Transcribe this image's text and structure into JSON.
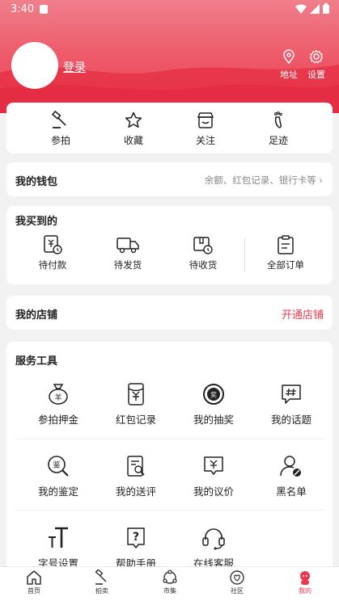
{
  "status": {
    "time": "3:40"
  },
  "header": {
    "login": "登录",
    "address": "地址",
    "settings": "设置"
  },
  "quick": [
    {
      "label": "参拍",
      "icon": "gavel-icon"
    },
    {
      "label": "收藏",
      "icon": "star-icon"
    },
    {
      "label": "关注",
      "icon": "shop-icon"
    },
    {
      "label": "足迹",
      "icon": "footprint-icon"
    }
  ],
  "wallet": {
    "title": "我的钱包",
    "hint": "余额、红包记录、银行卡等 ›"
  },
  "bought": {
    "title": "我买到的",
    "items": [
      {
        "label": "待付款",
        "icon": "payment-pending-icon"
      },
      {
        "label": "待发货",
        "icon": "truck-icon"
      },
      {
        "label": "待收货",
        "icon": "package-icon"
      },
      {
        "label": "全部订单",
        "icon": "clipboard-icon"
      }
    ]
  },
  "shop": {
    "title": "我的店铺",
    "action": "开通店铺"
  },
  "tools": {
    "title": "服务工具",
    "items": [
      {
        "label": "参拍押金",
        "icon": "money-bag-icon"
      },
      {
        "label": "红包记录",
        "icon": "red-packet-icon"
      },
      {
        "label": "我的抽奖",
        "icon": "lottery-wheel-icon"
      },
      {
        "label": "我的话题",
        "icon": "topic-hash-icon"
      },
      {
        "label": "我的鉴定",
        "icon": "appraisal-search-icon"
      },
      {
        "label": "我的送评",
        "icon": "review-document-icon"
      },
      {
        "label": "我的议价",
        "icon": "bargain-chat-icon"
      },
      {
        "label": "黑名单",
        "icon": "blocked-user-icon"
      },
      {
        "label": "字号设置",
        "icon": "font-size-icon"
      },
      {
        "label": "帮助手册",
        "icon": "help-book-icon"
      },
      {
        "label": "在线客服",
        "icon": "headset-icon"
      }
    ]
  },
  "tabbar": [
    {
      "label": "首页",
      "icon": "home-icon"
    },
    {
      "label": "拍卖",
      "icon": "gavel-icon"
    },
    {
      "label": "市集",
      "icon": "market-icon"
    },
    {
      "label": "社区",
      "icon": "community-icon"
    },
    {
      "label": "我的",
      "icon": "profile-icon"
    }
  ],
  "colors": {
    "accent": "#e8384f",
    "hero": "#ee5d6c"
  }
}
